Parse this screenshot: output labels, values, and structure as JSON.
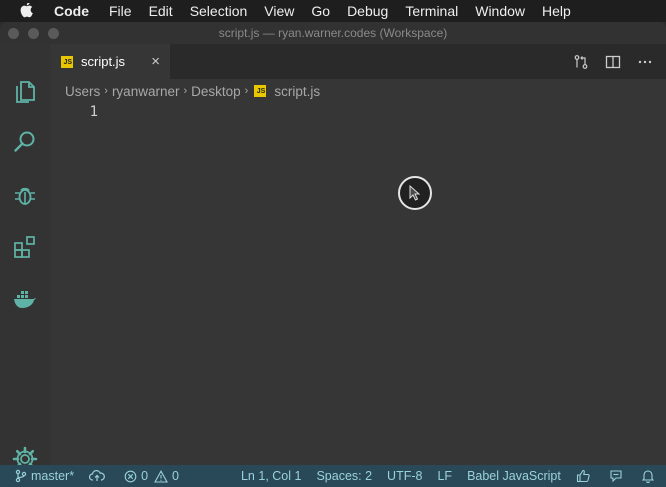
{
  "menubar": {
    "apple_icon": "apple-icon",
    "app_name": "Code",
    "items": [
      "File",
      "Edit",
      "Selection",
      "View",
      "Go",
      "Debug",
      "Terminal",
      "Window",
      "Help"
    ]
  },
  "window": {
    "title": "script.js — ryan.warner.codes (Workspace)"
  },
  "activity_bar": {
    "icons": [
      "files-icon",
      "search-icon",
      "debug-icon",
      "extensions-icon",
      "docker-icon",
      "gear-icon"
    ]
  },
  "tab": {
    "label": "script.js",
    "icon": "js",
    "close": "×"
  },
  "tab_actions": [
    "open-changes-icon",
    "split-editor-icon",
    "more-actions-icon"
  ],
  "breadcrumb": {
    "items": [
      "Users",
      "ryanwarner",
      "Desktop",
      "script.js"
    ],
    "separator": "›"
  },
  "editor": {
    "line_numbers": [
      "1"
    ]
  },
  "status_bar": {
    "branch": "master*",
    "errors": "0",
    "warnings": "0",
    "position": "Ln 1, Col 1",
    "spaces": "Spaces: 2",
    "encoding": "UTF-8",
    "eol": "LF",
    "language": "Babel JavaScript"
  },
  "colors": {
    "status_bar_bg": "#294858",
    "status_text": "#9ad2d9",
    "js_icon": "#e8c700",
    "activity_icon": "#5fb3a6"
  }
}
